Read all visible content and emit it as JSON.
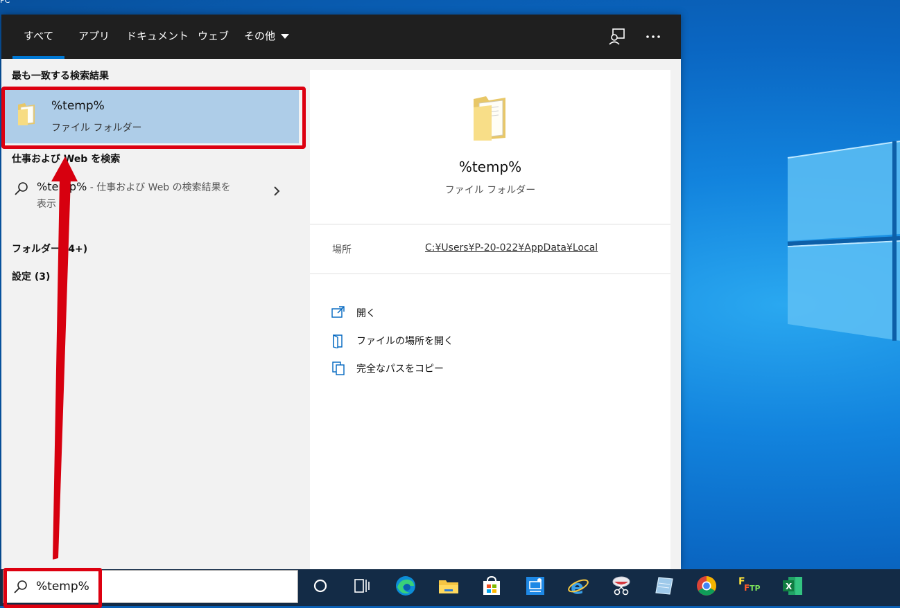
{
  "top_strip": {
    "partial_label": "PC"
  },
  "filter_bar": {
    "tabs": [
      "すべて",
      "アプリ",
      "ドキュメント",
      "ウェブ",
      "その他"
    ],
    "active_tab": "すべて",
    "icons": [
      "feedback-icon",
      "more-options-icon"
    ]
  },
  "results": {
    "best_match_heading": "最も一致する検索結果",
    "best_match": {
      "title": "%temp%",
      "subtitle": "ファイル フォルダー"
    },
    "web_heading": "仕事および Web を検索",
    "web_item": {
      "query": "%temp%",
      "rest": " - 仕事および Web の検索結果を",
      "rest2": "表示"
    },
    "folders_heading": "フォルダー (4+)",
    "settings_heading": "設定 (3)"
  },
  "preview": {
    "title": "%temp%",
    "subtitle": "ファイル フォルダー",
    "location_label": "場所",
    "location_value": "C:¥Users¥P-20-022¥AppData¥Local",
    "actions": [
      "開く",
      "ファイルの場所を開く",
      "完全なパスをコピー"
    ]
  },
  "taskbar": {
    "search_value": "%temp%",
    "apps": [
      "cortana-icon",
      "task-view-icon",
      "edge-icon",
      "file-explorer-icon",
      "store-icon",
      "remote-icon",
      "ie-icon",
      "snipping-icon",
      "notepad-icon",
      "chrome-icon",
      "ftp-icon",
      "excel-icon"
    ]
  },
  "colors": {
    "accent": "#0078d4",
    "highlight_red": "#dd0010",
    "best_match_bg": "#aecde8",
    "taskbar_bg": "#132b46"
  }
}
